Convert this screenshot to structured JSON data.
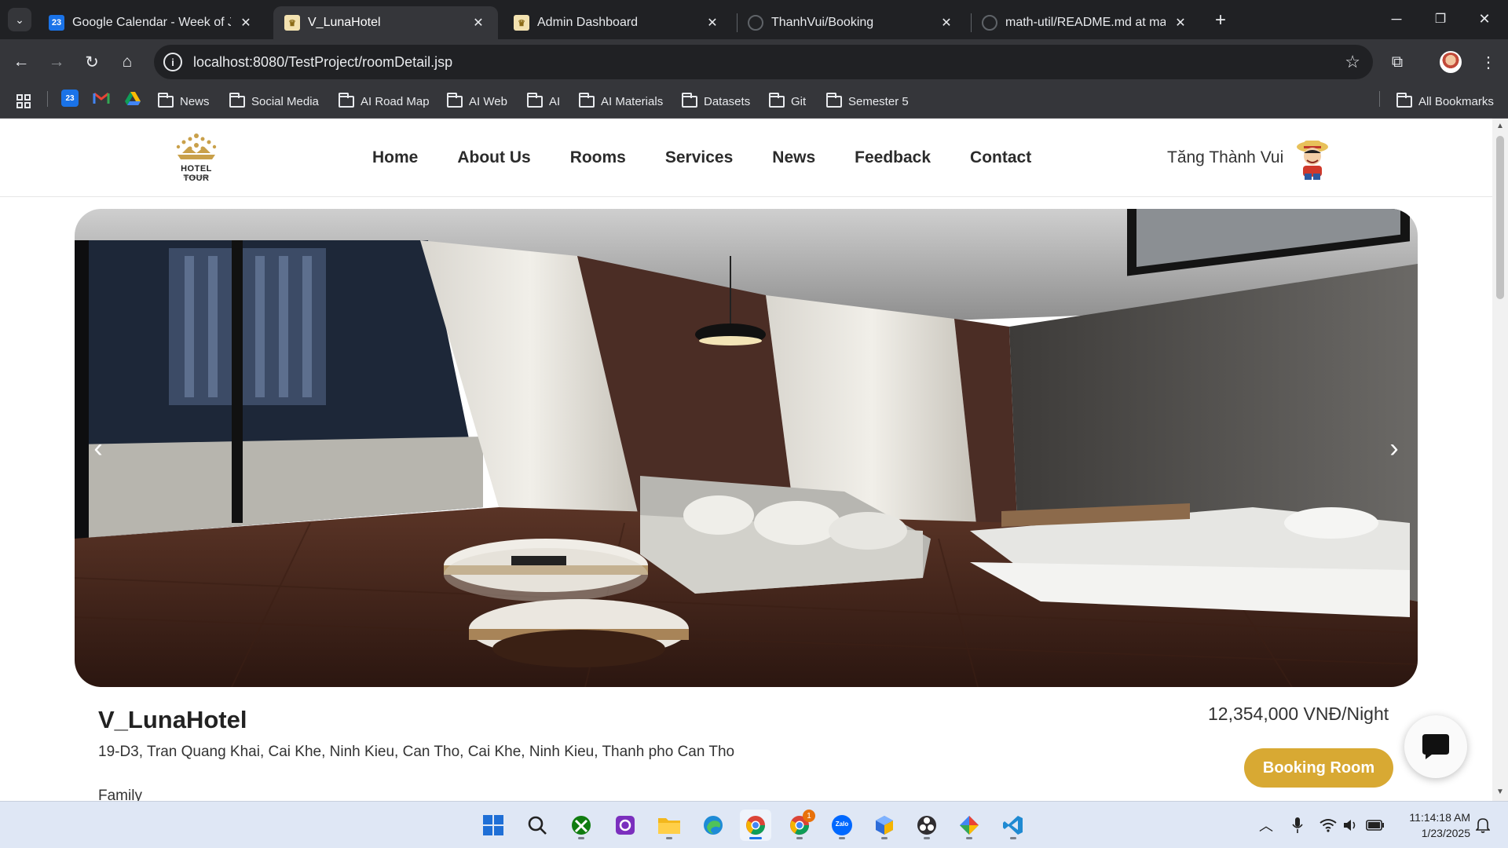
{
  "browser": {
    "tabs": [
      {
        "title": "Google Calendar - Week of Janu",
        "icon": "google-calendar-icon",
        "active": false
      },
      {
        "title": "V_LunaHotel",
        "icon": "hotel-favicon",
        "active": true
      },
      {
        "title": "Admin Dashboard",
        "icon": "hotel-favicon",
        "active": false
      },
      {
        "title": "ThanhVui/Booking",
        "icon": "github-icon",
        "active": false
      },
      {
        "title": "math-util/README.md at main",
        "icon": "github-icon",
        "active": false
      }
    ],
    "url": "localhost:8080/TestProject/roomDetail.jsp",
    "bookmarks": [
      {
        "label": "News"
      },
      {
        "label": "Social Media"
      },
      {
        "label": "AI Road Map"
      },
      {
        "label": "AI Web"
      },
      {
        "label": "AI"
      },
      {
        "label": "AI Materials"
      },
      {
        "label": "Datasets"
      },
      {
        "label": "Git"
      },
      {
        "label": "Semester 5"
      }
    ],
    "all_bookmarks_label": "All Bookmarks",
    "calendar_badge": "23"
  },
  "site": {
    "logo_text": "HOTEL TOUR",
    "logo_subtext": "HOTEL TOUR",
    "nav": [
      {
        "label": "Home"
      },
      {
        "label": "About Us"
      },
      {
        "label": "Rooms"
      },
      {
        "label": "Services"
      },
      {
        "label": "News"
      },
      {
        "label": "Feedback"
      },
      {
        "label": "Contact"
      }
    ],
    "user_name": "Tăng Thành Vui",
    "carousel_prev": "‹",
    "carousel_next": "›"
  },
  "hotel": {
    "name": "V_LunaHotel",
    "address": "19-D3, Tran Quang Khai, Cai Khe, Ninh Kieu, Can Tho, Cai Khe, Ninh Kieu, Thanh pho Can Tho",
    "type": "Family",
    "price": "12,354,000 VNĐ/Night",
    "booking_label": "Booking Room"
  },
  "taskbar": {
    "apps": [
      {
        "name": "windows-start-icon"
      },
      {
        "name": "search-icon"
      },
      {
        "name": "xbox-icon"
      },
      {
        "name": "clipchamp-icon"
      },
      {
        "name": "file-explorer-icon"
      },
      {
        "name": "edge-icon"
      },
      {
        "name": "chrome-icon",
        "active": true
      },
      {
        "name": "chrome-profile-icon",
        "badge": "1"
      },
      {
        "name": "zalo-icon",
        "label": "Zalo"
      },
      {
        "name": "box-app-icon"
      },
      {
        "name": "obs-icon"
      },
      {
        "name": "feather-app-icon"
      },
      {
        "name": "vscode-icon"
      }
    ],
    "time": "11:14:18 AM",
    "date": "1/23/2025"
  },
  "colors": {
    "accent_gold": "#d8a933",
    "chrome_dark": "#202124",
    "chrome_toolbar": "#35363a",
    "taskbar_bg": "#dfe7f5"
  }
}
